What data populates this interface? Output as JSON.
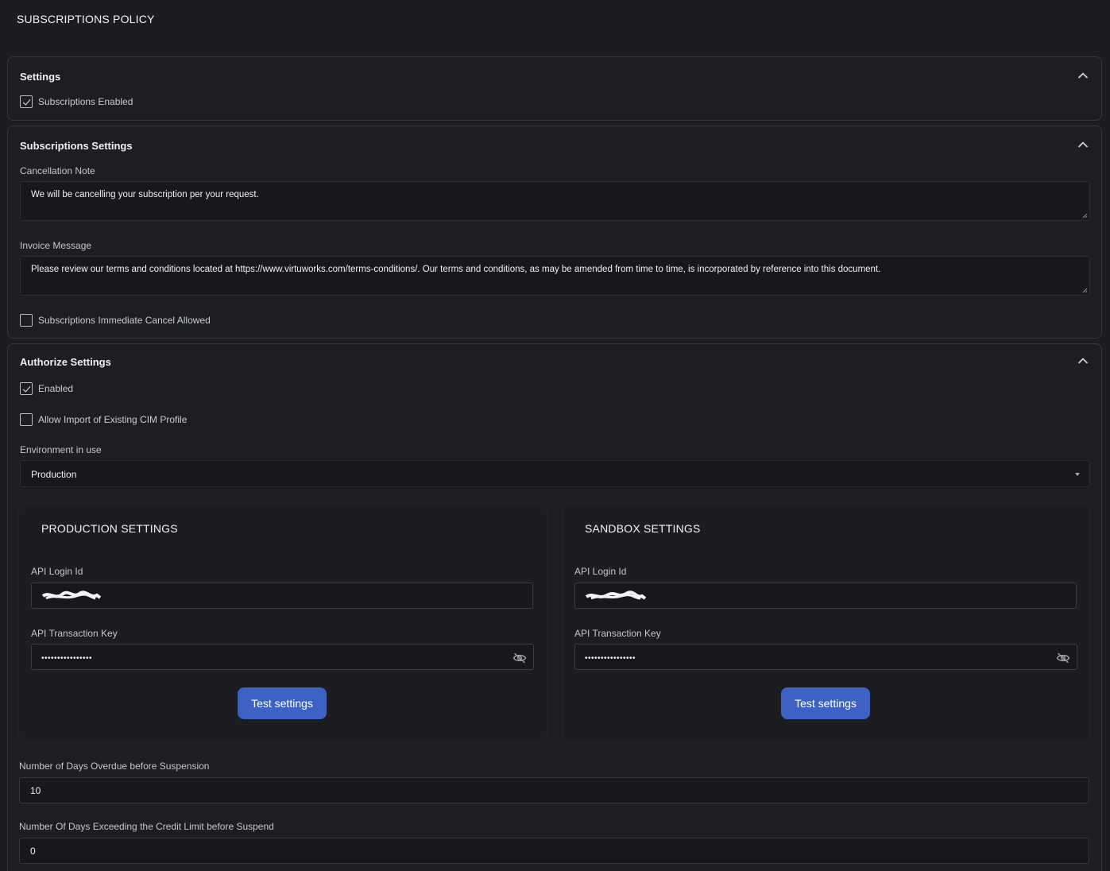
{
  "page": {
    "title": "SUBSCRIPTIONS POLICY"
  },
  "settings": {
    "title": "Settings",
    "subscriptions_enabled": {
      "label": "Subscriptions Enabled",
      "checked": true
    }
  },
  "subscriptions_settings": {
    "title": "Subscriptions Settings",
    "cancellation_note": {
      "label": "Cancellation Note",
      "value": "We will be cancelling your subscription per your request."
    },
    "invoice_message": {
      "label": "Invoice Message",
      "value": "Please review our terms and conditions located at https://www.virtuworks.com/terms-conditions/. Our terms and conditions, as may be amended from time to time, is incorporated by reference into this document."
    },
    "immediate_cancel": {
      "label": "Subscriptions Immediate Cancel Allowed",
      "checked": false
    }
  },
  "authorize_settings": {
    "title": "Authorize Settings",
    "enabled": {
      "label": "Enabled",
      "checked": true
    },
    "allow_import": {
      "label": "Allow Import of Existing CIM Profile",
      "checked": false
    },
    "environment": {
      "label": "Environment in use",
      "value": "Production"
    },
    "production": {
      "title": "PRODUCTION SETTINGS",
      "api_login_label": "API Login Id",
      "api_login_value": "[redacted]",
      "api_key_label": "API Transaction Key",
      "api_key_value": "••••••••••••••••",
      "test_button": "Test settings"
    },
    "sandbox": {
      "title": "SANDBOX SETTINGS",
      "api_login_label": "API Login Id",
      "api_login_value": "[redacted]",
      "api_key_label": "API Transaction Key",
      "api_key_value": "••••••••••••••••",
      "test_button": "Test settings"
    },
    "days_overdue": {
      "label": "Number of Days Overdue before Suspension",
      "value": "10"
    },
    "days_credit_limit": {
      "label": "Number Of Days Exceeding the Credit Limit before Suspend",
      "value": "0"
    }
  },
  "icons": {
    "collapse": "chevron-up-icon",
    "hidden": "eye-off-icon",
    "dropdown": "caret-down-icon",
    "check": "checkmark-icon"
  },
  "colors": {
    "background": "#1c1d21",
    "input_background": "#17181b",
    "border": "#34363b",
    "button": "#3e62c4",
    "text": "#e6e7ea"
  }
}
